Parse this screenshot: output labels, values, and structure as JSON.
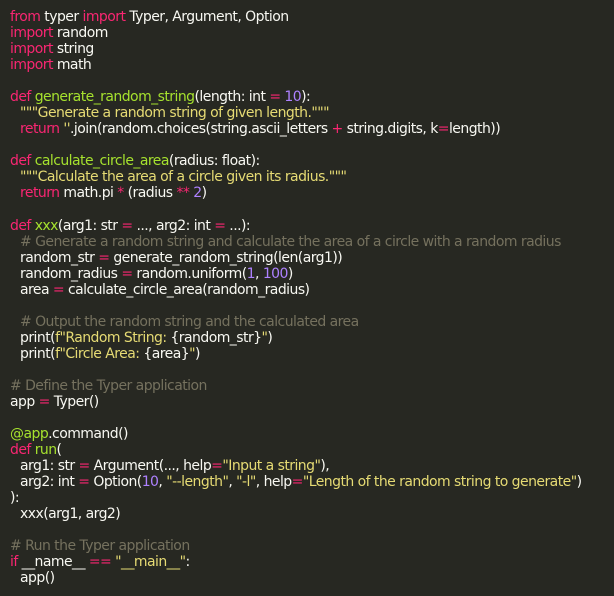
{
  "code": {
    "lines": [
      {
        "indent": 0,
        "tokens": [
          [
            "kw",
            "from"
          ],
          [
            "plain",
            " typer "
          ],
          [
            "kw",
            "import"
          ],
          [
            "plain",
            " Typer, Argument, Option"
          ]
        ]
      },
      {
        "indent": 0,
        "tokens": [
          [
            "kw",
            "import"
          ],
          [
            "plain",
            " random"
          ]
        ]
      },
      {
        "indent": 0,
        "tokens": [
          [
            "kw",
            "import"
          ],
          [
            "plain",
            " string"
          ]
        ]
      },
      {
        "indent": 0,
        "tokens": [
          [
            "kw",
            "import"
          ],
          [
            "plain",
            " math"
          ]
        ]
      },
      {
        "indent": 0,
        "tokens": []
      },
      {
        "indent": 0,
        "tokens": [
          [
            "kw",
            "def"
          ],
          [
            "plain",
            " "
          ],
          [
            "fn",
            "generate_random_string"
          ],
          [
            "plain",
            "(length: int "
          ],
          [
            "op",
            "="
          ],
          [
            "plain",
            " "
          ],
          [
            "num",
            "10"
          ],
          [
            "plain",
            "):"
          ]
        ]
      },
      {
        "indent": 1,
        "tokens": [
          [
            "str",
            "\"\"\"Generate a random string of given length.\"\"\""
          ]
        ]
      },
      {
        "indent": 1,
        "tokens": [
          [
            "kw",
            "return"
          ],
          [
            "plain",
            " "
          ],
          [
            "str",
            "''"
          ],
          [
            "plain",
            ".join(random.choices(string.ascii_letters "
          ],
          [
            "op",
            "+"
          ],
          [
            "plain",
            " string.digits, k"
          ],
          [
            "op",
            "="
          ],
          [
            "plain",
            "length))"
          ]
        ]
      },
      {
        "indent": 0,
        "tokens": []
      },
      {
        "indent": 0,
        "tokens": [
          [
            "kw",
            "def"
          ],
          [
            "plain",
            " "
          ],
          [
            "fn",
            "calculate_circle_area"
          ],
          [
            "plain",
            "(radius: float):"
          ]
        ]
      },
      {
        "indent": 1,
        "tokens": [
          [
            "str",
            "\"\"\"Calculate the area of a circle given its radius.\"\"\""
          ]
        ]
      },
      {
        "indent": 1,
        "tokens": [
          [
            "kw",
            "return"
          ],
          [
            "plain",
            " math.pi "
          ],
          [
            "op",
            "*"
          ],
          [
            "plain",
            " (radius "
          ],
          [
            "op",
            "**"
          ],
          [
            "plain",
            " "
          ],
          [
            "num",
            "2"
          ],
          [
            "plain",
            ")"
          ]
        ]
      },
      {
        "indent": 0,
        "tokens": []
      },
      {
        "indent": 0,
        "tokens": [
          [
            "kw",
            "def"
          ],
          [
            "plain",
            " "
          ],
          [
            "fn",
            "xxx"
          ],
          [
            "plain",
            "(arg1: str "
          ],
          [
            "op",
            "="
          ],
          [
            "plain",
            " ..., arg2: int "
          ],
          [
            "op",
            "="
          ],
          [
            "plain",
            " ...):"
          ]
        ]
      },
      {
        "indent": 1,
        "tokens": [
          [
            "cm",
            "# Generate a random string and calculate the area of a circle with a random radius"
          ]
        ]
      },
      {
        "indent": 1,
        "tokens": [
          [
            "plain",
            "random_str "
          ],
          [
            "op",
            "="
          ],
          [
            "plain",
            " generate_random_string(len(arg1))"
          ]
        ]
      },
      {
        "indent": 1,
        "tokens": [
          [
            "plain",
            "random_radius "
          ],
          [
            "op",
            "="
          ],
          [
            "plain",
            " random.uniform("
          ],
          [
            "num",
            "1"
          ],
          [
            "plain",
            ", "
          ],
          [
            "num",
            "100"
          ],
          [
            "plain",
            ")"
          ]
        ]
      },
      {
        "indent": 1,
        "tokens": [
          [
            "plain",
            "area "
          ],
          [
            "op",
            "="
          ],
          [
            "plain",
            " calculate_circle_area(random_radius)"
          ]
        ]
      },
      {
        "indent": 0,
        "tokens": []
      },
      {
        "indent": 1,
        "tokens": [
          [
            "cm",
            "# Output the random string and the calculated area"
          ]
        ]
      },
      {
        "indent": 1,
        "tokens": [
          [
            "plain",
            "print("
          ],
          [
            "str",
            "f\"Random String: "
          ],
          [
            "plain",
            "{random_str}"
          ],
          [
            "str",
            "\""
          ],
          [
            "plain",
            ")"
          ]
        ]
      },
      {
        "indent": 1,
        "tokens": [
          [
            "plain",
            "print("
          ],
          [
            "str",
            "f\"Circle Area: "
          ],
          [
            "plain",
            "{area}"
          ],
          [
            "str",
            "\""
          ],
          [
            "plain",
            ")"
          ]
        ]
      },
      {
        "indent": 0,
        "tokens": []
      },
      {
        "indent": 0,
        "tokens": [
          [
            "cm",
            "# Define the Typer application"
          ]
        ]
      },
      {
        "indent": 0,
        "tokens": [
          [
            "plain",
            "app "
          ],
          [
            "op",
            "="
          ],
          [
            "plain",
            " Typer()"
          ]
        ]
      },
      {
        "indent": 0,
        "tokens": []
      },
      {
        "indent": 0,
        "tokens": [
          [
            "dec",
            "@app"
          ],
          [
            "plain",
            ".command()"
          ]
        ]
      },
      {
        "indent": 0,
        "tokens": [
          [
            "kw",
            "def"
          ],
          [
            "plain",
            " "
          ],
          [
            "fn",
            "run"
          ],
          [
            "plain",
            "("
          ]
        ]
      },
      {
        "indent": 1,
        "tokens": [
          [
            "plain",
            "arg1: str "
          ],
          [
            "op",
            "="
          ],
          [
            "plain",
            " Argument(..., help"
          ],
          [
            "op",
            "="
          ],
          [
            "str",
            "\"Input a string\""
          ],
          [
            "plain",
            "),"
          ]
        ]
      },
      {
        "indent": 1,
        "tokens": [
          [
            "plain",
            "arg2: int "
          ],
          [
            "op",
            "="
          ],
          [
            "plain",
            " Option("
          ],
          [
            "num",
            "10"
          ],
          [
            "plain",
            ", "
          ],
          [
            "str",
            "\"--length\""
          ],
          [
            "plain",
            ", "
          ],
          [
            "str",
            "\"-l\""
          ],
          [
            "plain",
            ", help"
          ],
          [
            "op",
            "="
          ],
          [
            "str",
            "\"Length of the random string to generate\""
          ],
          [
            "plain",
            ")"
          ]
        ]
      },
      {
        "indent": 0,
        "tokens": [
          [
            "plain",
            "):"
          ]
        ]
      },
      {
        "indent": 1,
        "tokens": [
          [
            "plain",
            "xxx(arg1, arg2)"
          ]
        ]
      },
      {
        "indent": 0,
        "tokens": []
      },
      {
        "indent": 0,
        "tokens": [
          [
            "cm",
            "# Run the Typer application"
          ]
        ]
      },
      {
        "indent": 0,
        "tokens": [
          [
            "kw",
            "if"
          ],
          [
            "plain",
            " __name__ "
          ],
          [
            "op",
            "=="
          ],
          [
            "plain",
            " "
          ],
          [
            "str",
            "\"__main__\""
          ],
          [
            "plain",
            ":"
          ]
        ]
      },
      {
        "indent": 1,
        "tokens": [
          [
            "plain",
            "app()"
          ]
        ]
      }
    ]
  },
  "colors": {
    "background": "#272822",
    "keyword": "#f92672",
    "function": "#a6e22e",
    "number": "#ae81ff",
    "string": "#e6db74",
    "comment": "#75715e",
    "text": "#f8f8f2"
  }
}
